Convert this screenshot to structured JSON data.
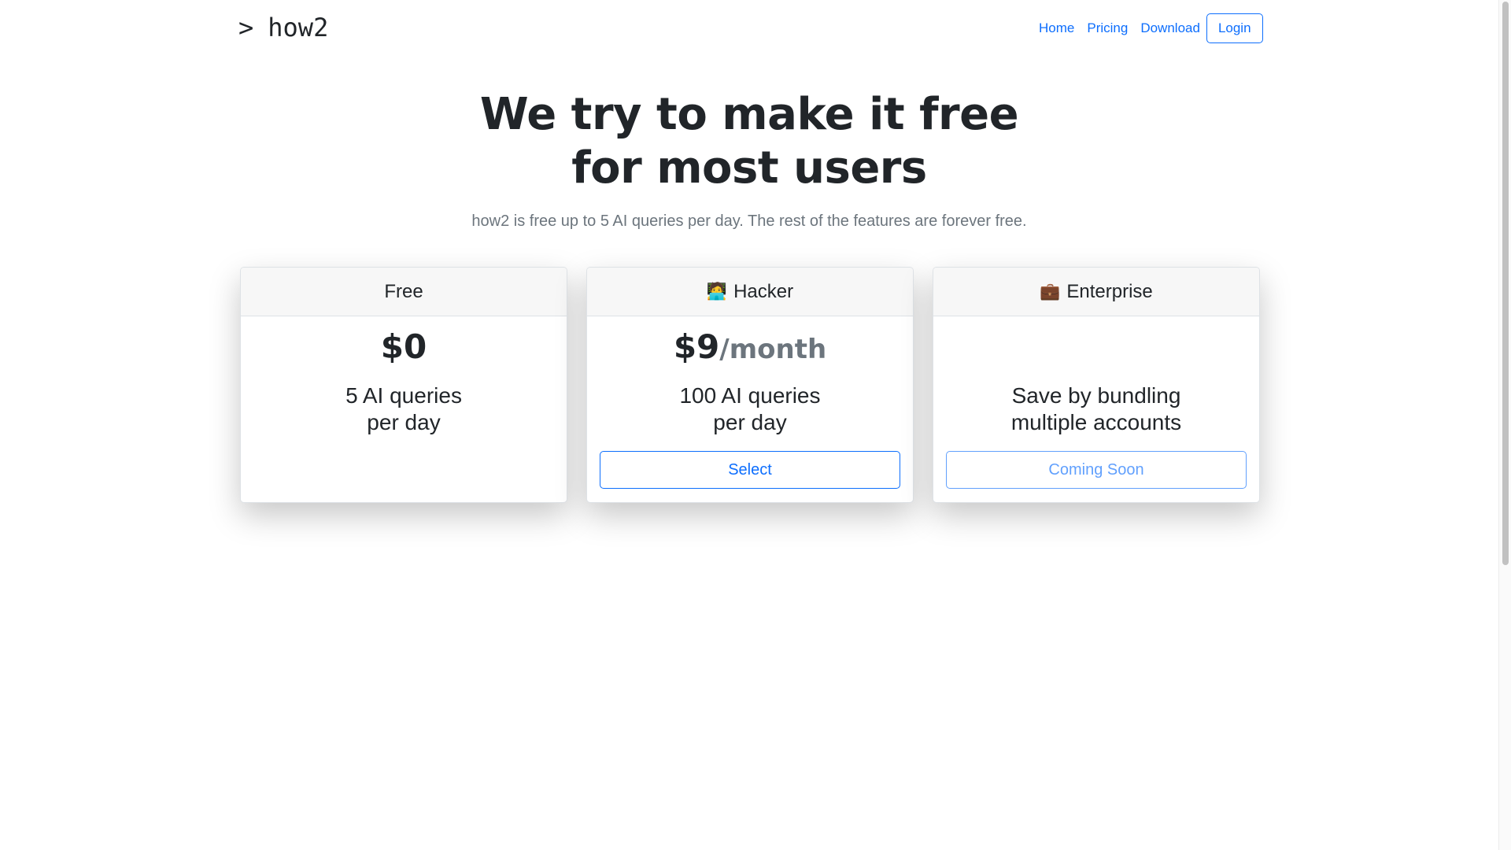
{
  "header": {
    "logo_prompt": ">",
    "logo_text": "how2",
    "nav": {
      "home": "Home",
      "pricing": "Pricing",
      "download": "Download",
      "login": "Login"
    }
  },
  "hero": {
    "title_line1": "We try to make it free",
    "title_line2": "for most users",
    "subtitle": "how2 is free up to 5 AI queries per day. The rest of the features are forever free."
  },
  "plans": [
    {
      "emoji": "",
      "name": "Free",
      "price": "$0",
      "period": "",
      "feature_line1": "5 AI queries",
      "feature_line2": "per day",
      "button": ""
    },
    {
      "emoji": "🧑‍💻",
      "name": "Hacker",
      "price": "$9",
      "period": "/month",
      "feature_line1": "100 AI queries",
      "feature_line2": "per day",
      "button": "Select"
    },
    {
      "emoji": "💼",
      "name": "Enterprise",
      "price": "",
      "period": "",
      "feature_line1": "Save by bundling",
      "feature_line2": "multiple accounts",
      "button": "Coming Soon"
    }
  ],
  "colors": {
    "accent": "#0d6efd",
    "text": "#212529",
    "muted": "#6c757d",
    "card_header_bg": "#f7f7f7"
  }
}
